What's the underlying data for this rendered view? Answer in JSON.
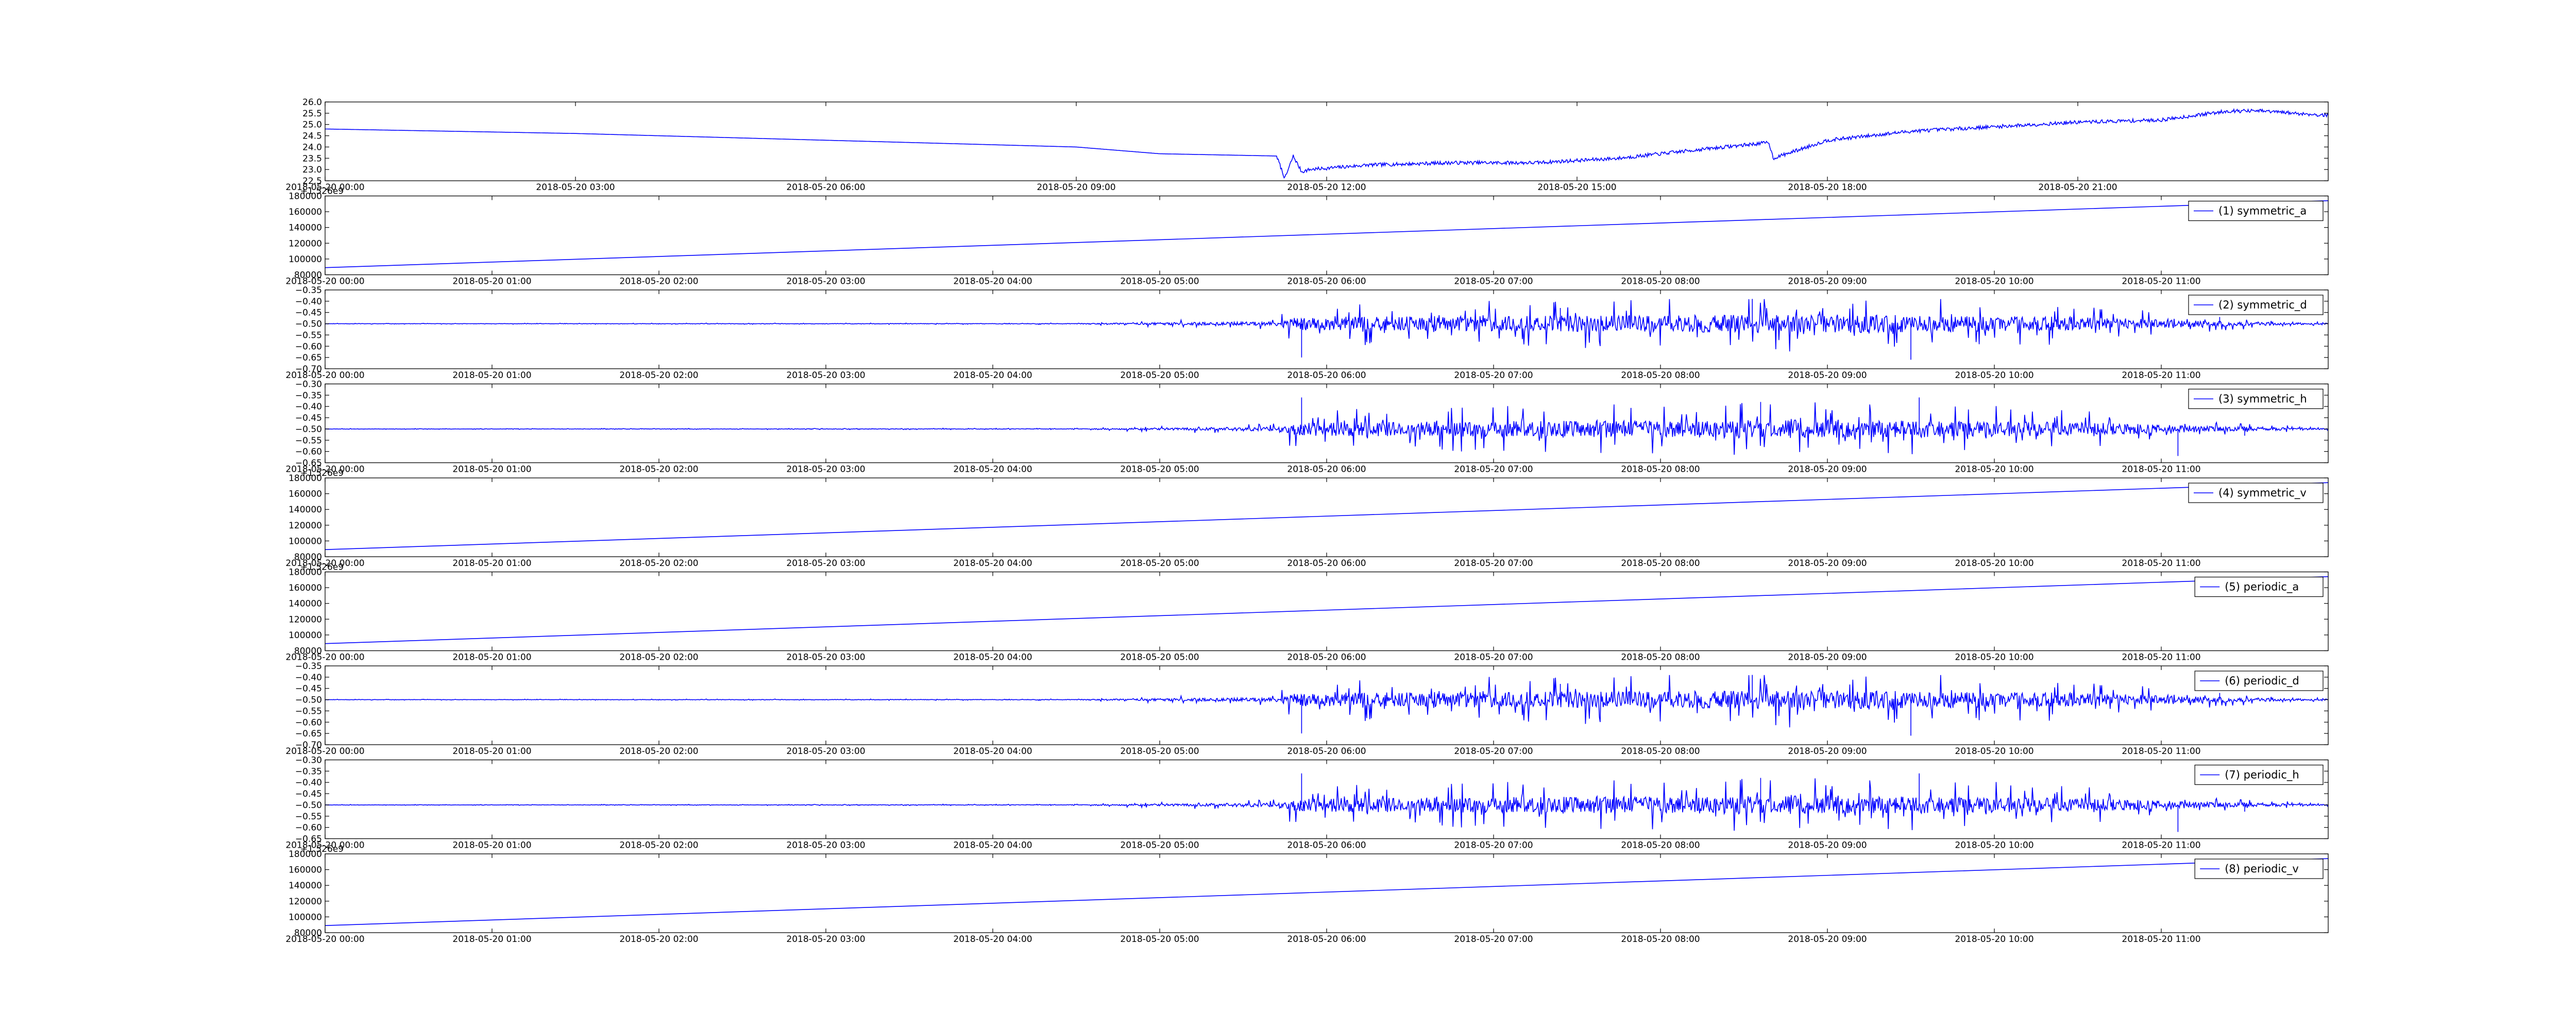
{
  "figure": {
    "background": "#ffffff"
  },
  "style": {
    "line_color": "#0000ff",
    "axes_color": "#000000",
    "legend_border": "#000000"
  },
  "chart_data": [
    {
      "type": "line",
      "title": "",
      "xlabel": "",
      "ylabel": "",
      "offset_text": "",
      "legend": null,
      "grid": false,
      "x_ticks": [
        "2018-05-20 00:00",
        "2018-05-20 03:00",
        "2018-05-20 06:00",
        "2018-05-20 09:00",
        "2018-05-20 12:00",
        "2018-05-20 15:00",
        "2018-05-20 18:00",
        "2018-05-20 21:00"
      ],
      "x_range_hours": [
        0,
        24
      ],
      "y_ticks": [
        "22.5",
        "23.0",
        "23.5",
        "24.0",
        "24.5",
        "25.0",
        "25.5",
        "26.0"
      ],
      "ylim": [
        22.5,
        26.0
      ],
      "series": [
        {
          "kind": "temperature",
          "x_hours": [
            0,
            3,
            6,
            9,
            10,
            11.4,
            11.5,
            11.6,
            11.7,
            11.8,
            12.5,
            13.5,
            14.5,
            15.5,
            16.5,
            17.3,
            17.35,
            18,
            19,
            20,
            21,
            22,
            22.8,
            23.2,
            24
          ],
          "y": [
            24.8,
            24.6,
            24.3,
            24.0,
            23.7,
            23.6,
            22.6,
            23.6,
            22.9,
            23.0,
            23.2,
            23.3,
            23.3,
            23.5,
            23.9,
            24.2,
            23.5,
            24.3,
            24.7,
            24.9,
            25.1,
            25.2,
            25.6,
            25.6,
            25.4
          ],
          "noise": 0.08
        }
      ]
    },
    {
      "type": "line",
      "title": "",
      "xlabel": "",
      "ylabel": "",
      "offset_text": "+1.526e9",
      "legend": "(1) symmetric_a",
      "legend_position": "top-right",
      "grid": false,
      "x_ticks": [
        "2018-05-20 00:00",
        "2018-05-20 01:00",
        "2018-05-20 02:00",
        "2018-05-20 03:00",
        "2018-05-20 04:00",
        "2018-05-20 05:00",
        "2018-05-20 06:00",
        "2018-05-20 07:00",
        "2018-05-20 08:00",
        "2018-05-20 09:00",
        "2018-05-20 10:00",
        "2018-05-20 11:00"
      ],
      "x_range_hours": [
        0,
        12
      ],
      "y_ticks": [
        "80000",
        "100000",
        "120000",
        "140000",
        "160000",
        "180000"
      ],
      "ylim": [
        80000,
        180000
      ],
      "series": [
        {
          "kind": "linear",
          "name": "(1) symmetric_a",
          "start": 89000,
          "end": 174000
        }
      ]
    },
    {
      "type": "line",
      "title": "",
      "xlabel": "",
      "ylabel": "",
      "offset_text": "",
      "legend": "(2) symmetric_d",
      "legend_position": "top-right",
      "grid": false,
      "x_ticks": [
        "2018-05-20 00:00",
        "2018-05-20 01:00",
        "2018-05-20 02:00",
        "2018-05-20 03:00",
        "2018-05-20 04:00",
        "2018-05-20 05:00",
        "2018-05-20 06:00",
        "2018-05-20 07:00",
        "2018-05-20 08:00",
        "2018-05-20 09:00",
        "2018-05-20 10:00",
        "2018-05-20 11:00"
      ],
      "x_range_hours": [
        0,
        12
      ],
      "y_ticks": [
        "−0.70",
        "−0.65",
        "−0.60",
        "−0.55",
        "−0.50",
        "−0.45",
        "−0.40",
        "−0.35"
      ],
      "ylim": [
        -0.7,
        -0.35
      ],
      "series": [
        {
          "kind": "noise",
          "name": "(2) symmetric_d",
          "baseline": -0.5,
          "seed": 11,
          "envelope_hours": [
            0,
            4.5,
            5,
            5.7,
            5.8,
            7.5,
            9,
            10.5,
            11.3,
            12
          ],
          "envelope_amp": [
            0.001,
            0.002,
            0.008,
            0.015,
            0.05,
            0.06,
            0.07,
            0.05,
            0.02,
            0.003
          ],
          "spikes": [
            [
              5.85,
              -0.65
            ],
            [
              7.4,
              -0.43
            ],
            [
              8.55,
              -0.39
            ],
            [
              9.5,
              -0.66
            ],
            [
              11.35,
              -0.47
            ]
          ]
        }
      ]
    },
    {
      "type": "line",
      "title": "",
      "xlabel": "",
      "ylabel": "",
      "offset_text": "",
      "legend": "(3) symmetric_h",
      "legend_position": "top-right",
      "grid": false,
      "x_ticks": [
        "2018-05-20 00:00",
        "2018-05-20 01:00",
        "2018-05-20 02:00",
        "2018-05-20 03:00",
        "2018-05-20 04:00",
        "2018-05-20 05:00",
        "2018-05-20 06:00",
        "2018-05-20 07:00",
        "2018-05-20 08:00",
        "2018-05-20 09:00",
        "2018-05-20 10:00",
        "2018-05-20 11:00"
      ],
      "x_range_hours": [
        0,
        12
      ],
      "y_ticks": [
        "−0.65",
        "−0.60",
        "−0.55",
        "−0.50",
        "−0.45",
        "−0.40",
        "−0.35",
        "−0.30"
      ],
      "ylim": [
        -0.65,
        -0.3
      ],
      "series": [
        {
          "kind": "noise",
          "name": "(3) symmetric_h",
          "baseline": -0.5,
          "seed": 23,
          "envelope_hours": [
            0,
            4.5,
            5,
            5.7,
            5.8,
            7.5,
            9,
            10.5,
            11.3,
            12
          ],
          "envelope_amp": [
            0.001,
            0.002,
            0.008,
            0.015,
            0.05,
            0.06,
            0.07,
            0.05,
            0.02,
            0.003
          ],
          "spikes": [
            [
              5.85,
              -0.36
            ],
            [
              8.6,
              -0.38
            ],
            [
              9.55,
              -0.36
            ],
            [
              11.1,
              -0.62
            ],
            [
              11.5,
              -0.53
            ]
          ]
        }
      ]
    },
    {
      "type": "line",
      "title": "",
      "xlabel": "",
      "ylabel": "",
      "offset_text": "+1.526e9",
      "legend": "(4) symmetric_v",
      "legend_position": "top-right",
      "grid": false,
      "x_ticks": [
        "2018-05-20 00:00",
        "2018-05-20 01:00",
        "2018-05-20 02:00",
        "2018-05-20 03:00",
        "2018-05-20 04:00",
        "2018-05-20 05:00",
        "2018-05-20 06:00",
        "2018-05-20 07:00",
        "2018-05-20 08:00",
        "2018-05-20 09:00",
        "2018-05-20 10:00",
        "2018-05-20 11:00"
      ],
      "x_range_hours": [
        0,
        12
      ],
      "y_ticks": [
        "80000",
        "100000",
        "120000",
        "140000",
        "160000",
        "180000"
      ],
      "ylim": [
        80000,
        180000
      ],
      "series": [
        {
          "kind": "linear",
          "name": "(4) symmetric_v",
          "start": 89000,
          "end": 174000
        }
      ]
    },
    {
      "type": "line",
      "title": "",
      "xlabel": "",
      "ylabel": "",
      "offset_text": "+1.526e9",
      "legend": "(5) periodic_a",
      "legend_position": "top-right",
      "grid": false,
      "x_ticks": [
        "2018-05-20 00:00",
        "2018-05-20 01:00",
        "2018-05-20 02:00",
        "2018-05-20 03:00",
        "2018-05-20 04:00",
        "2018-05-20 05:00",
        "2018-05-20 06:00",
        "2018-05-20 07:00",
        "2018-05-20 08:00",
        "2018-05-20 09:00",
        "2018-05-20 10:00",
        "2018-05-20 11:00"
      ],
      "x_range_hours": [
        0,
        12
      ],
      "y_ticks": [
        "80000",
        "100000",
        "120000",
        "140000",
        "160000",
        "180000"
      ],
      "ylim": [
        80000,
        180000
      ],
      "series": [
        {
          "kind": "linear",
          "name": "(5) periodic_a",
          "start": 89000,
          "end": 174000
        }
      ]
    },
    {
      "type": "line",
      "title": "",
      "xlabel": "",
      "ylabel": "",
      "offset_text": "",
      "legend": "(6) periodic_d",
      "legend_position": "top-right",
      "grid": false,
      "x_ticks": [
        "2018-05-20 00:00",
        "2018-05-20 01:00",
        "2018-05-20 02:00",
        "2018-05-20 03:00",
        "2018-05-20 04:00",
        "2018-05-20 05:00",
        "2018-05-20 06:00",
        "2018-05-20 07:00",
        "2018-05-20 08:00",
        "2018-05-20 09:00",
        "2018-05-20 10:00",
        "2018-05-20 11:00"
      ],
      "x_range_hours": [
        0,
        12
      ],
      "y_ticks": [
        "−0.70",
        "−0.65",
        "−0.60",
        "−0.55",
        "−0.50",
        "−0.45",
        "−0.40",
        "−0.35"
      ],
      "ylim": [
        -0.7,
        -0.35
      ],
      "series": [
        {
          "kind": "noise",
          "name": "(6) periodic_d",
          "baseline": -0.5,
          "seed": 11,
          "envelope_hours": [
            0,
            4.5,
            5,
            5.7,
            5.8,
            7.5,
            9,
            10.5,
            11.3,
            12
          ],
          "envelope_amp": [
            0.001,
            0.002,
            0.008,
            0.015,
            0.05,
            0.06,
            0.07,
            0.05,
            0.02,
            0.003
          ],
          "spikes": [
            [
              5.85,
              -0.65
            ],
            [
              7.4,
              -0.43
            ],
            [
              8.55,
              -0.39
            ],
            [
              9.5,
              -0.66
            ],
            [
              11.35,
              -0.47
            ]
          ]
        }
      ]
    },
    {
      "type": "line",
      "title": "",
      "xlabel": "",
      "ylabel": "",
      "offset_text": "",
      "legend": "(7) periodic_h",
      "legend_position": "top-right",
      "grid": false,
      "x_ticks": [
        "2018-05-20 00:00",
        "2018-05-20 01:00",
        "2018-05-20 02:00",
        "2018-05-20 03:00",
        "2018-05-20 04:00",
        "2018-05-20 05:00",
        "2018-05-20 06:00",
        "2018-05-20 07:00",
        "2018-05-20 08:00",
        "2018-05-20 09:00",
        "2018-05-20 10:00",
        "2018-05-20 11:00"
      ],
      "x_range_hours": [
        0,
        12
      ],
      "y_ticks": [
        "−0.65",
        "−0.60",
        "−0.55",
        "−0.50",
        "−0.45",
        "−0.40",
        "−0.35",
        "−0.30"
      ],
      "ylim": [
        -0.65,
        -0.3
      ],
      "series": [
        {
          "kind": "noise",
          "name": "(7) periodic_h",
          "baseline": -0.5,
          "seed": 23,
          "envelope_hours": [
            0,
            4.5,
            5,
            5.7,
            5.8,
            7.5,
            9,
            10.5,
            11.3,
            12
          ],
          "envelope_amp": [
            0.001,
            0.002,
            0.008,
            0.015,
            0.05,
            0.06,
            0.07,
            0.05,
            0.02,
            0.003
          ],
          "spikes": [
            [
              5.85,
              -0.36
            ],
            [
              8.6,
              -0.38
            ],
            [
              9.55,
              -0.36
            ],
            [
              11.1,
              -0.62
            ],
            [
              11.5,
              -0.53
            ]
          ]
        }
      ]
    },
    {
      "type": "line",
      "title": "",
      "xlabel": "",
      "ylabel": "",
      "offset_text": "+1.526e9",
      "legend": "(8) periodic_v",
      "legend_position": "top-right",
      "grid": false,
      "x_ticks": [
        "2018-05-20 00:00",
        "2018-05-20 01:00",
        "2018-05-20 02:00",
        "2018-05-20 03:00",
        "2018-05-20 04:00",
        "2018-05-20 05:00",
        "2018-05-20 06:00",
        "2018-05-20 07:00",
        "2018-05-20 08:00",
        "2018-05-20 09:00",
        "2018-05-20 10:00",
        "2018-05-20 11:00"
      ],
      "x_range_hours": [
        0,
        12
      ],
      "y_ticks": [
        "80000",
        "100000",
        "120000",
        "140000",
        "160000",
        "180000"
      ],
      "ylim": [
        80000,
        180000
      ],
      "series": [
        {
          "kind": "linear",
          "name": "(8) periodic_v",
          "start": 89000,
          "end": 174000
        }
      ]
    }
  ]
}
